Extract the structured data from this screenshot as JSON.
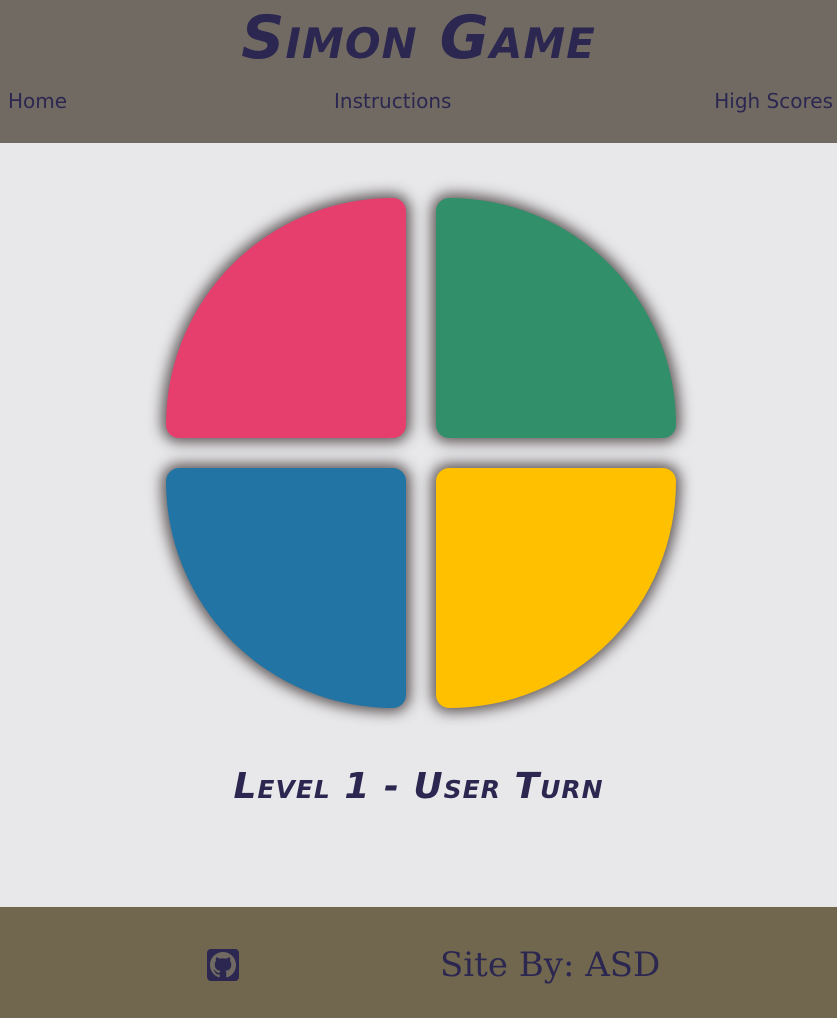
{
  "header": {
    "title": "Simon Game",
    "nav": {
      "home": "Home",
      "instructions": "Instructions",
      "high_scores": "High Scores"
    }
  },
  "game": {
    "pads": [
      {
        "color_name": "red",
        "color": "#e63e6d"
      },
      {
        "color_name": "green",
        "color": "#318f6a"
      },
      {
        "color_name": "blue",
        "color": "#2274a5"
      },
      {
        "color_name": "yellow",
        "color": "#ffc000"
      }
    ],
    "status": "Level 1 - User Turn"
  },
  "footer": {
    "github_icon": "github-icon",
    "credit": "Site By: ASD"
  },
  "colors": {
    "header_bg": "#716a62",
    "main_bg": "#e8e8ea",
    "footer_bg": "#71674f",
    "text": "#2b2750"
  }
}
